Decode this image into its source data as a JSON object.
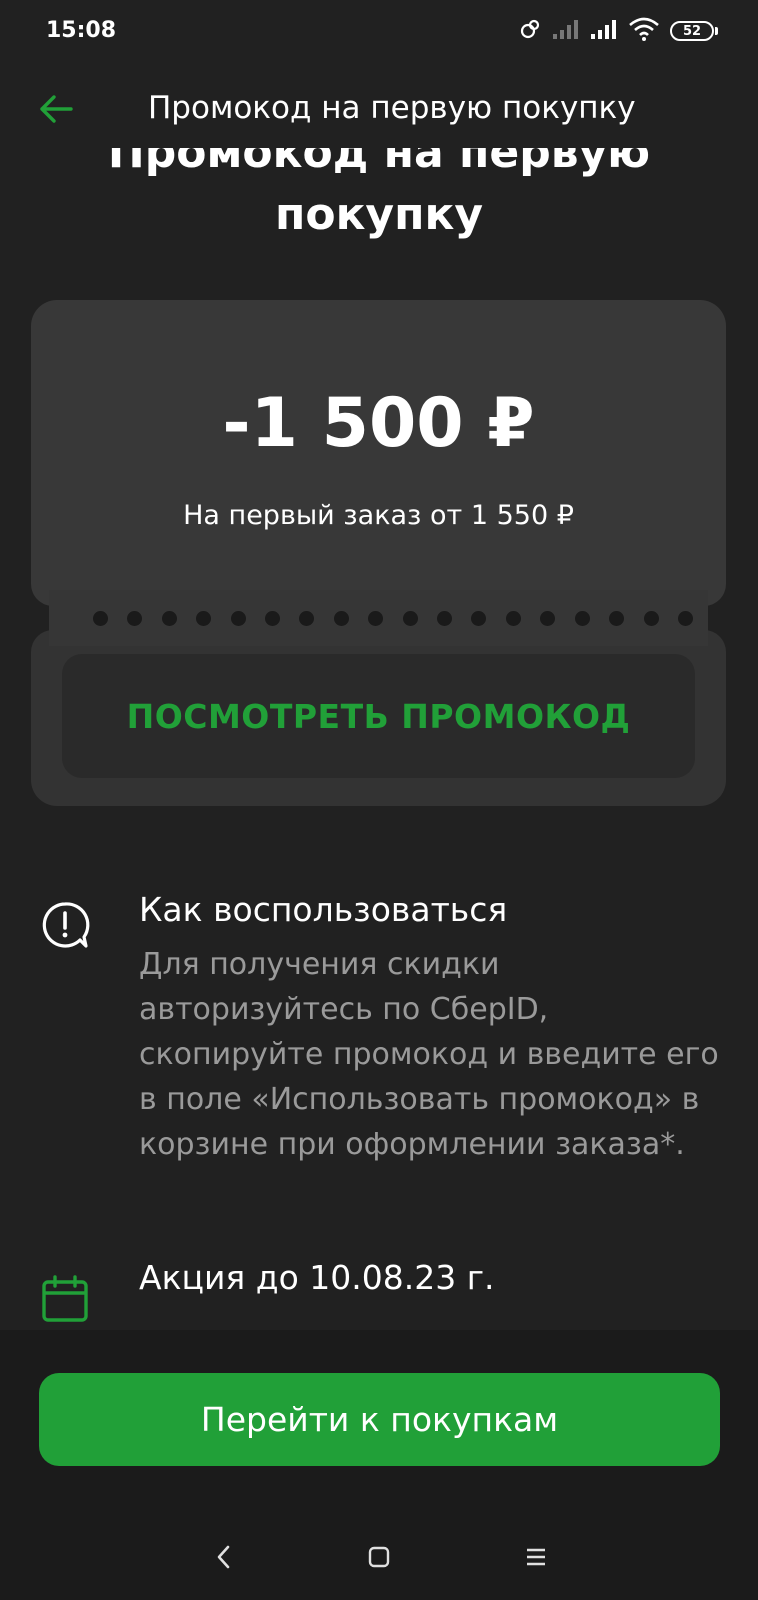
{
  "status_bar": {
    "time": "15:08",
    "battery": "52",
    "icons": [
      "link-icon",
      "signal-icon",
      "signal-icon",
      "wifi-icon",
      "battery-icon"
    ]
  },
  "header": {
    "title": "Промокод на первую покупку",
    "back_icon": "arrow-left-icon"
  },
  "page_title": "Промокод на первую покупку",
  "coupon": {
    "amount": "-1 500 ₽",
    "condition": "На первый заказ от 1 550 ₽",
    "button_label": "ПОСМОТРЕТЬ ПРОМОКОД"
  },
  "how_to": {
    "title": "Как воспользоваться",
    "text": "Для получения скидки авторизуйтесь по СберID, скопируйте промокод и введите его в поле «Использовать промокод» в корзине при оформлении заказа*.",
    "icon": "info-message-icon"
  },
  "promo_period": {
    "title": "Акция до 10.08.23 г.",
    "icon": "calendar-icon"
  },
  "cta": {
    "label": "Перейти к покупкам"
  },
  "nav_bar": {
    "icons": [
      "back-nav-icon",
      "home-nav-icon",
      "recents-nav-icon"
    ]
  },
  "colors": {
    "background": "#212121",
    "card": "#383838",
    "accent": "#21a038",
    "muted_text": "#9a9a9a"
  }
}
